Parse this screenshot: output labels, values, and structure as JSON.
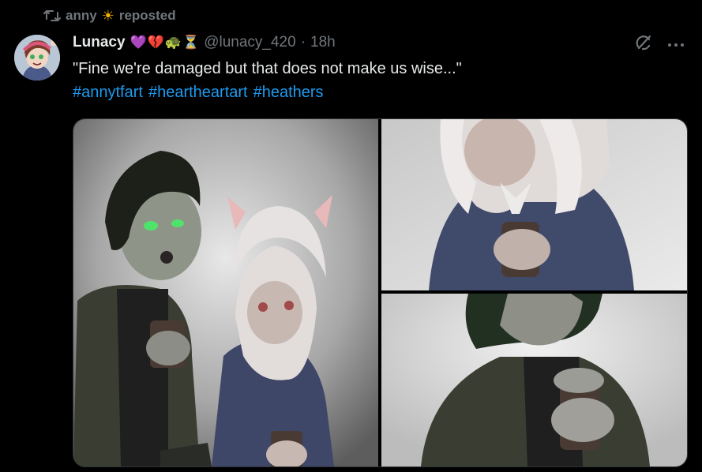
{
  "repost": {
    "user": "anny",
    "emoji": "☀",
    "label": "reposted"
  },
  "author": {
    "display_name": "Lunacy",
    "emojis": [
      "💜",
      "💔",
      "🐢",
      "⏳"
    ],
    "handle": "@lunacy_420",
    "separator": "·",
    "time": "18h"
  },
  "tweet": {
    "text": "\"Fine we're damaged but that does not make us wise...\"",
    "hashtags": [
      "#annytfart",
      "#heartheartart",
      "#heathers"
    ]
  },
  "media": {
    "images": [
      "left-illustration",
      "top-right-illustration",
      "bottom-right-illustration"
    ]
  },
  "icons": {
    "repost": "repost-icon",
    "grok": "grok-icon",
    "more": "more-icon"
  },
  "colors": {
    "background": "#000000",
    "primary_text": "#e7e9ea",
    "secondary_text": "#71767b",
    "link": "#1d9bf0"
  }
}
